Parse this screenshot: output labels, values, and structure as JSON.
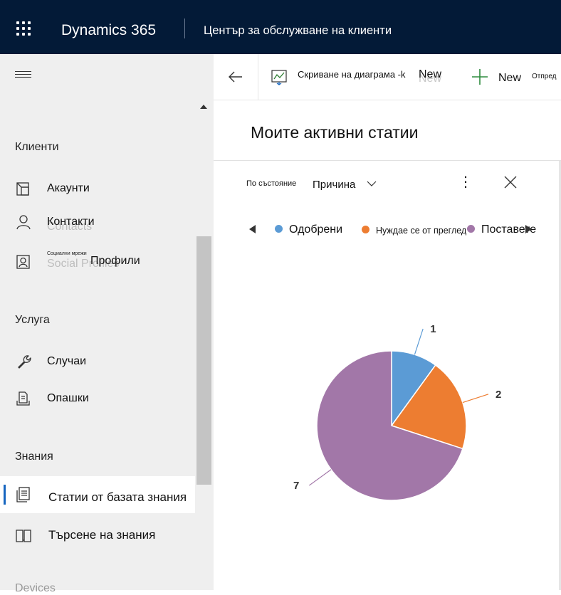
{
  "header": {
    "brand": "Dynamics 365",
    "app_name": "Център за обслужване на клиенти"
  },
  "sidebar": {
    "groups": [
      {
        "label": "Клиенти"
      },
      {
        "label": "Услуга"
      },
      {
        "label": "Знания"
      },
      {
        "label": "Devices"
      }
    ],
    "items": [
      {
        "label": "Акаунти",
        "icon": "account-icon"
      },
      {
        "label": "Контакти",
        "ghost": "Contacts",
        "icon": "contact-icon"
      },
      {
        "label": "Профили",
        "ghost": "Social Profiles",
        "tiny": "Социални мрежи",
        "icon": "social-profile-icon"
      },
      {
        "label": "Случаи",
        "icon": "wrench-icon"
      },
      {
        "label": "Опашки",
        "icon": "queue-icon"
      },
      {
        "label": "Статии от базата знания",
        "icon": "article-icon",
        "active": true
      },
      {
        "label": "Търсене на знания",
        "icon": "book-icon"
      }
    ]
  },
  "commandbar": {
    "hide_chart_label": "Скриване на диаграма -k",
    "new_overlay": "New",
    "new_ghost": "New",
    "new_label": "New",
    "more_label": "Отпред"
  },
  "main": {
    "page_title": "Моите активни статии"
  },
  "chart_panel": {
    "by_label": "По състояние",
    "by_value": "Причина",
    "legend": [
      {
        "name": "Одобрени",
        "color": "#5b9bd5"
      },
      {
        "name": "Нуждае се от преглед",
        "color": "#ed7d31"
      },
      {
        "name": "Поставете",
        "color": "#a277a8"
      }
    ]
  },
  "chart_data": {
    "type": "pie",
    "categories": [
      "Одобрени",
      "Нуждае се от преглед",
      "Поставете"
    ],
    "values": [
      1,
      2,
      7
    ],
    "colors": [
      "#5b9bd5",
      "#ed7d31",
      "#a277a8"
    ],
    "data_labels": [
      "1",
      "2",
      "7"
    ]
  }
}
